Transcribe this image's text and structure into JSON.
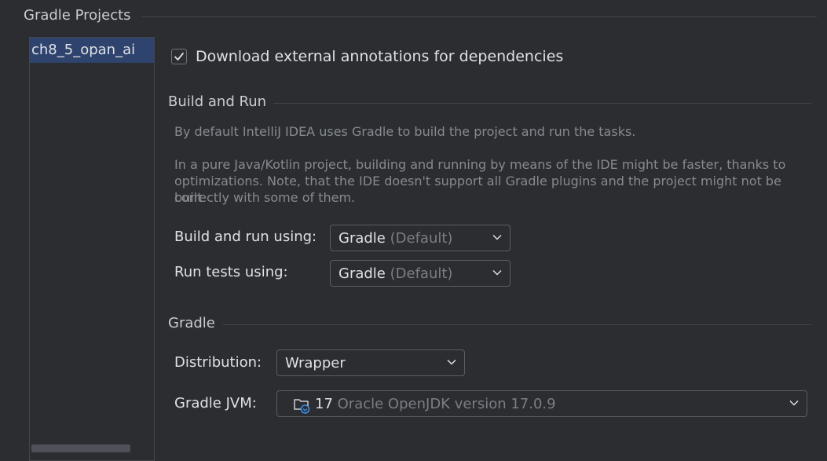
{
  "header": {
    "title": "Gradle Projects"
  },
  "projects": [
    {
      "label": "ch8_5_opan_ai",
      "selected": true
    }
  ],
  "options": {
    "download_annotations": {
      "label": "Download external annotations for dependencies",
      "checked": true
    }
  },
  "build_run": {
    "title": "Build and Run",
    "desc1": "By default IntelliJ IDEA uses Gradle to build the project and run the tasks.",
    "desc2_line1": "In a pure Java/Kotlin project, building and running by means of the IDE might be faster, thanks to",
    "desc2_line2": "optimizations. Note, that the IDE doesn't support all Gradle plugins and the project might not be built",
    "desc2_line3": "correctly with some of them.",
    "build_label": "Build and run using:",
    "build_value": "Gradle",
    "build_hint": "(Default)",
    "tests_label": "Run tests using:",
    "tests_value": "Gradle",
    "tests_hint": "(Default)"
  },
  "gradle": {
    "title": "Gradle",
    "distribution_label": "Distribution:",
    "distribution_value": "Wrapper",
    "jvm_label": "Gradle JVM:",
    "jvm_version": "17",
    "jvm_detail": "Oracle OpenJDK version 17.0.9"
  },
  "icons": {
    "checkbox": "check-icon",
    "chevron": "chevron-down-icon",
    "jdk": "jdk-folder-icon"
  },
  "colors": {
    "background": "#2b2d30",
    "selection": "#2e436e",
    "text": "#dfe1e5",
    "muted": "#868a91",
    "jdk_icon": "#3d8ee8"
  }
}
